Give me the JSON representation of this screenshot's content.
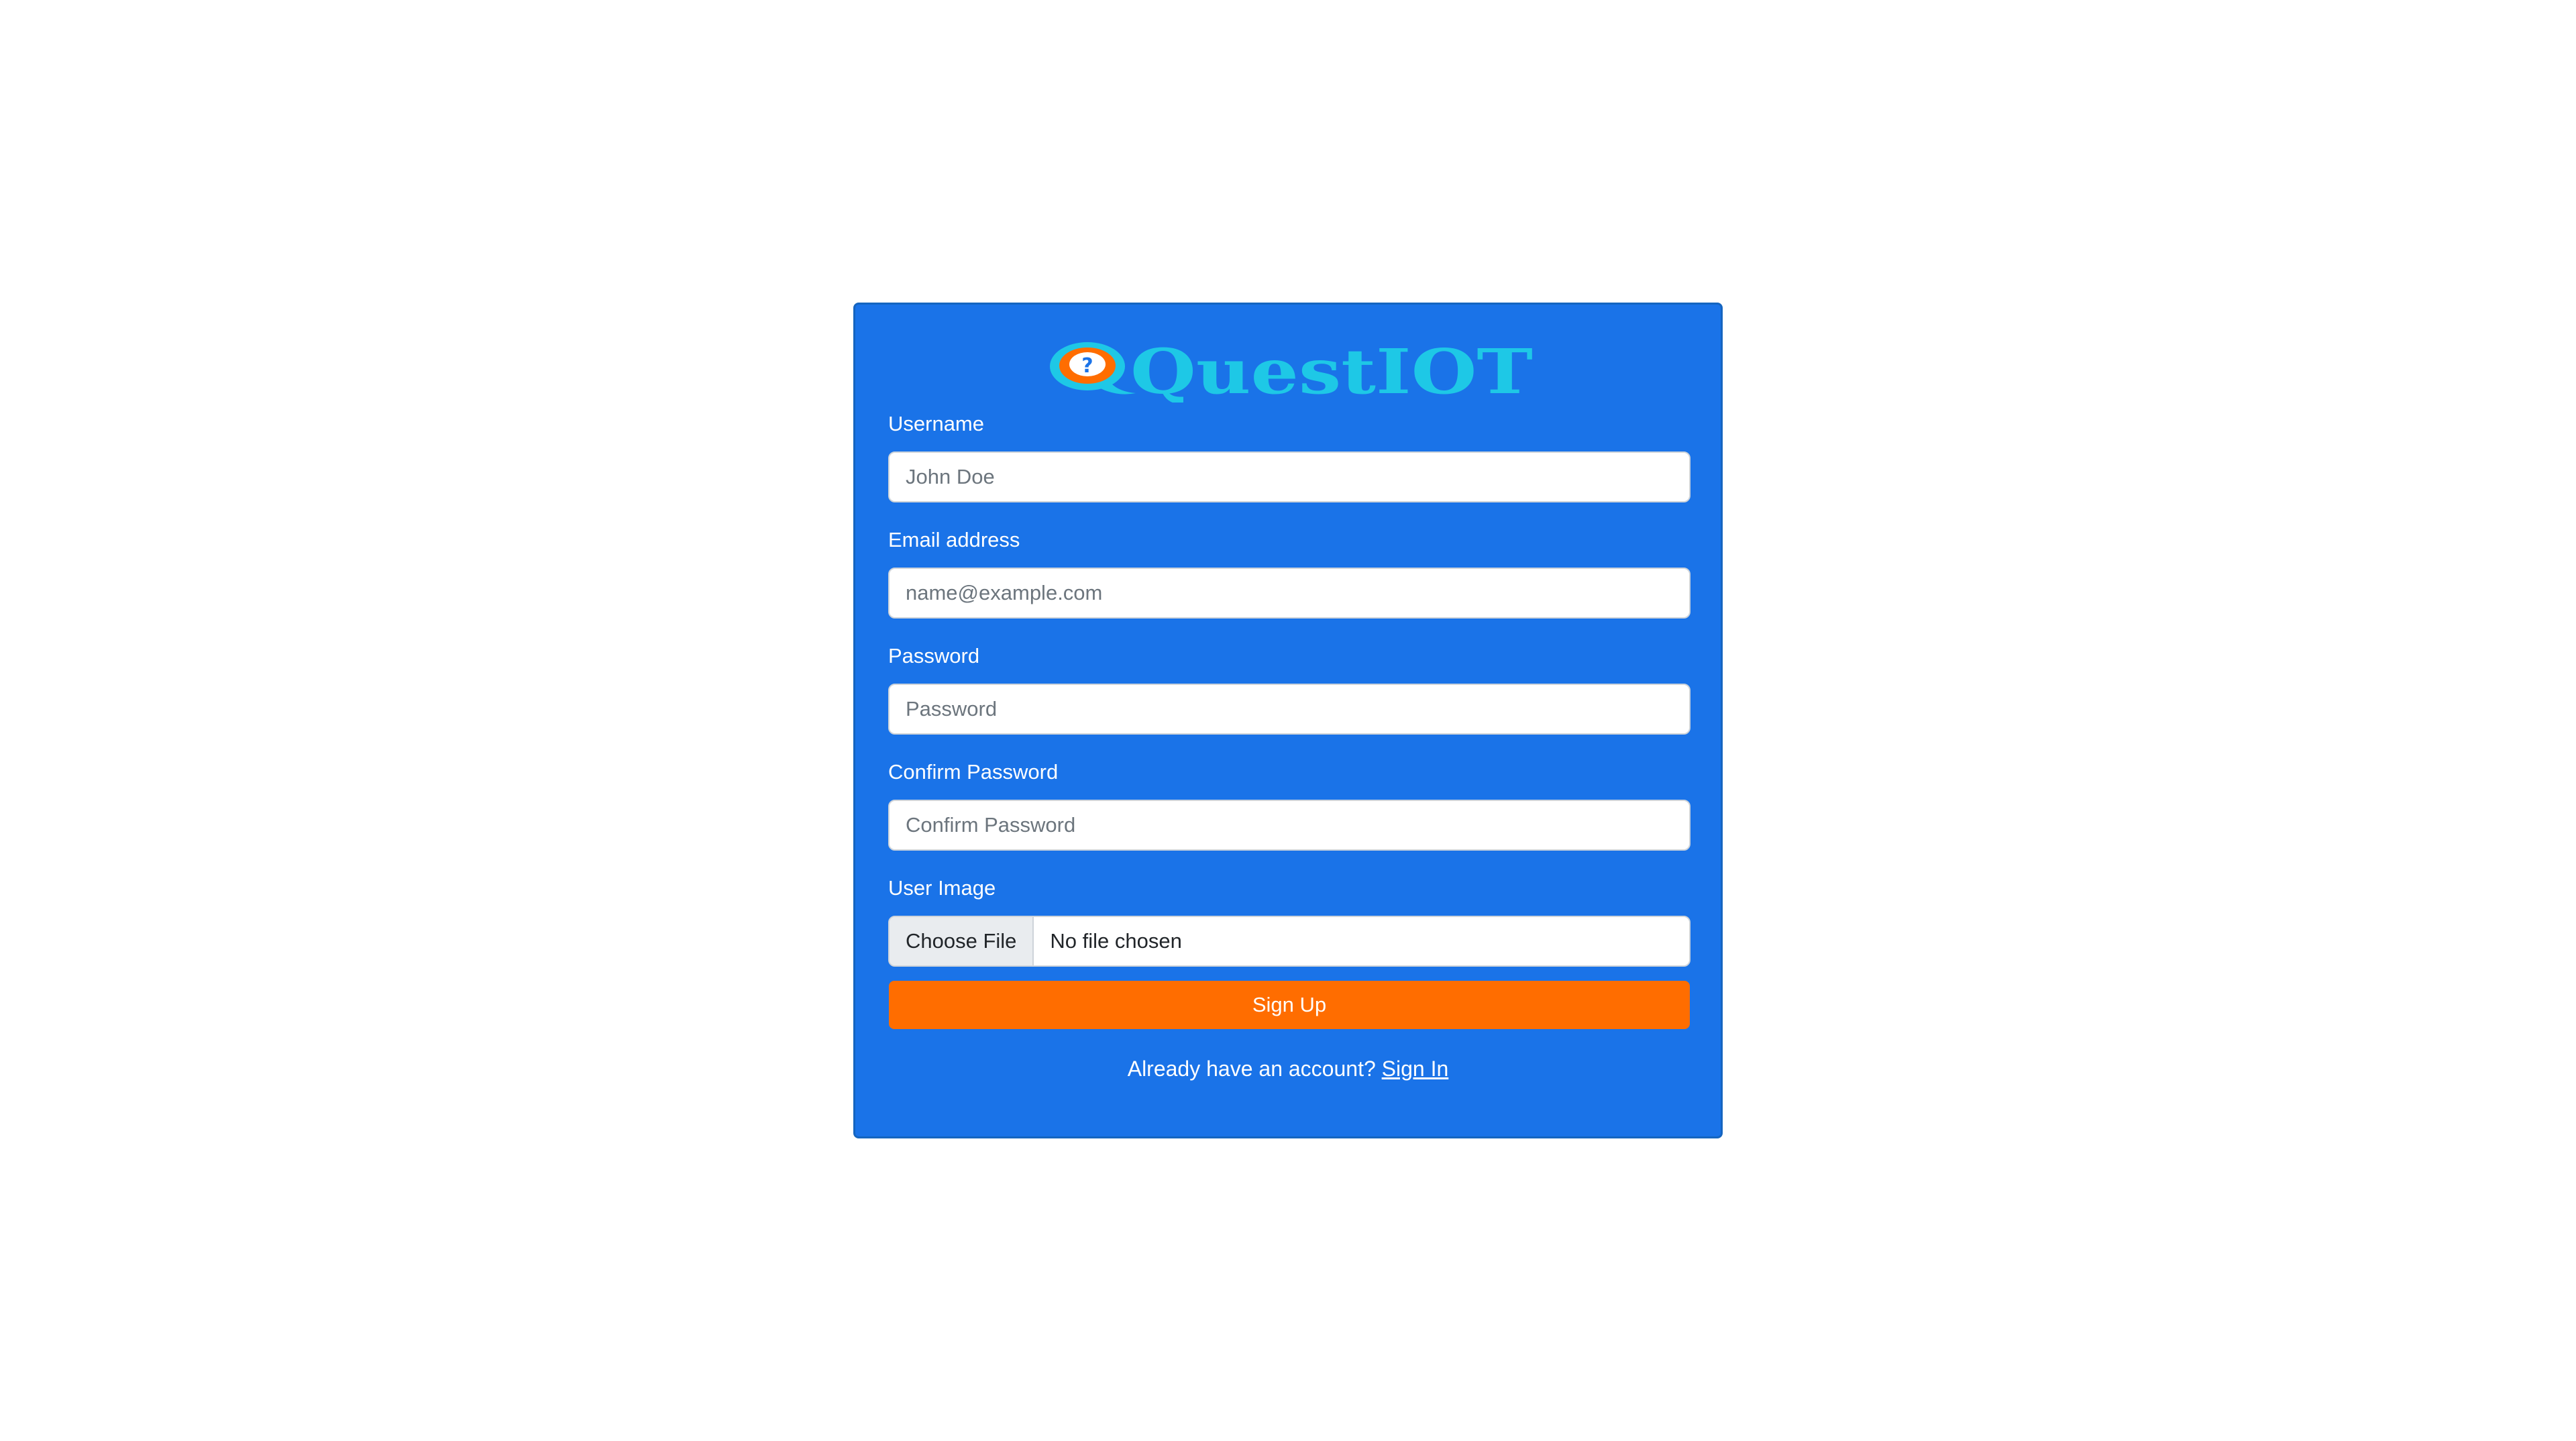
{
  "brand": {
    "logo_text": "QuestIOT",
    "logo_colors": {
      "text": "#1ec8e6",
      "bubble_outer": "#ff6d00",
      "bubble_inner": "#ffffff",
      "mark": "#1a73e8"
    }
  },
  "form": {
    "username": {
      "label": "Username",
      "placeholder": "John Doe"
    },
    "email": {
      "label": "Email address",
      "placeholder": "name@example.com"
    },
    "password": {
      "label": "Password",
      "placeholder": "Password"
    },
    "confirm_password": {
      "label": "Confirm Password",
      "placeholder": "Confirm Password"
    },
    "user_image": {
      "label": "User Image",
      "button_label": "Choose File",
      "status": "No file chosen"
    },
    "submit_label": "Sign Up"
  },
  "footer": {
    "prompt": "Already have an account?",
    "link_label": "Sign In"
  },
  "colors": {
    "card_background": "#1a73e8",
    "button_background": "#ff6d00",
    "page_background": "#ffffff"
  }
}
